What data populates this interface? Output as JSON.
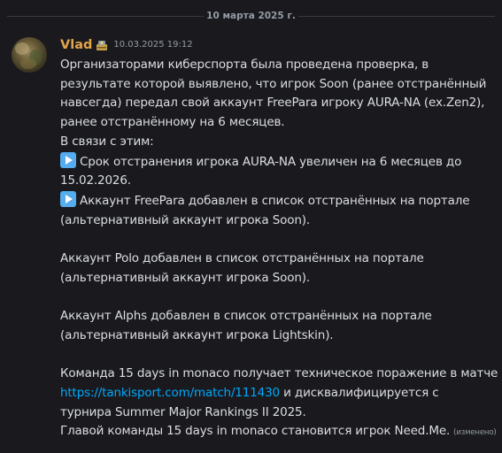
{
  "date_divider": "10 марта 2025 г.",
  "message": {
    "author": "Vlad",
    "role_icon": "moderator-badge-icon",
    "timestamp": "10.03.2025 19:12",
    "lines": {
      "l1": "Организаторами киберспорта была проведена проверка, в",
      "l2": "результате которой выявлено, что игрок Soon (ранее отстранённый",
      "l3": "навсегда) передал свой аккаунт FreePara игроку AURA-NA (ex.Zen2),",
      "l4": "ранее отстранённому на 6 месяцев.",
      "l5": "В связи с этим:",
      "l6": "Срок отстранения игрока AURA-NA увеличен на 6 месяцев до",
      "l7": "15.02.2026.",
      "l8": "Аккаунт FreePara добавлен в список отстранённых на портале",
      "l9": "(альтернативный аккаунт игрока Soon).",
      "l10": "Аккаунт Polo добавлен в список отстранённых на портале",
      "l11": "(альтернативный аккаунт игрока Soon).",
      "l12": "Аккаунт Alphs добавлен в список отстранённых на портале",
      "l13": "(альтернативный аккаунт игрока Lightskin).",
      "l14": "Команда 15 days in monaco получает техническое поражение в матче",
      "l15_link": "https://tankisport.com/match/111430",
      "l15_rest": " и дисквалифицируется с",
      "l16": "турнира Summer Major Rankings II 2025.",
      "l17": "Главой команды 15 days in monaco становится игрок Need.Me."
    },
    "bullet_icon": "play-button-icon",
    "edited_label": "(изменено)"
  },
  "colors": {
    "background": "#1a1a1e",
    "author": "#e3a44a",
    "link": "#00a8fc",
    "text": "#dbdee1",
    "muted": "#949ba4",
    "bullet": "#55acee"
  }
}
